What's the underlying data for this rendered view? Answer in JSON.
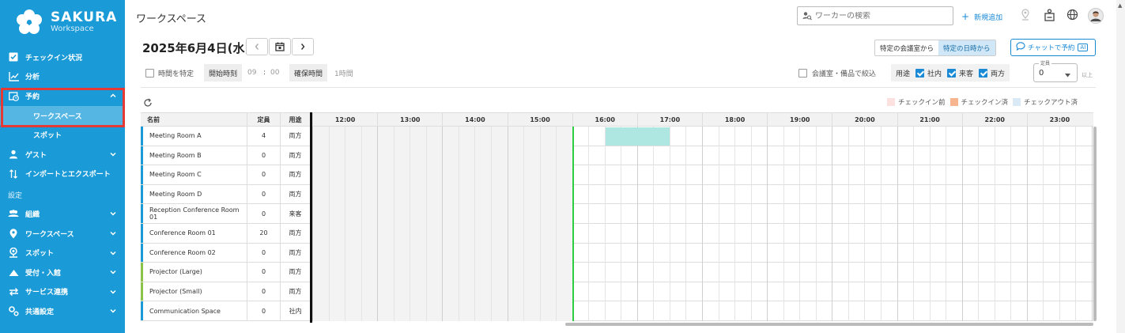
{
  "brand": {
    "name": "SAKURA",
    "sub": "Workspace"
  },
  "sidebar": {
    "items": [
      {
        "label": "チェックイン状況",
        "icon": "checkbox-icon"
      },
      {
        "label": "分析",
        "icon": "chart-line-icon"
      },
      {
        "label": "予約",
        "icon": "calendar-clock-icon",
        "expanded": true
      },
      {
        "label": "ワークスペース",
        "sub": true,
        "active": true
      },
      {
        "label": "スポット",
        "sub": true
      },
      {
        "label": "ゲスト",
        "icon": "guest-icon"
      },
      {
        "label": "インポートとエクスポート",
        "icon": "import-export-icon"
      }
    ],
    "section_label": "設定",
    "settings_items": [
      {
        "label": "組織",
        "icon": "group-icon"
      },
      {
        "label": "ワークスペース",
        "icon": "location-pin-icon"
      },
      {
        "label": "スポット",
        "icon": "person-pin-icon"
      },
      {
        "label": "受付・入館",
        "icon": "reception-icon"
      },
      {
        "label": "サービス連携",
        "icon": "sync-icon"
      },
      {
        "label": "共通設定",
        "icon": "gears-icon"
      }
    ]
  },
  "header": {
    "title": "ワークスペース",
    "search_placeholder": "ワーカーの検索",
    "new_add": "新規追加"
  },
  "date": {
    "label": "2025年6月4日(水)"
  },
  "segment": {
    "options": [
      "特定の会議室から",
      "特定の日時から"
    ],
    "selected_index": 1
  },
  "chat_button": {
    "label": "チャットで予約",
    "badge": "AI"
  },
  "filters": {
    "time_fix": "時間を特定",
    "start_label": "開始時刻",
    "start_hour": "09",
    "start_sep": ":",
    "start_min": "00",
    "duration_label": "確保時間",
    "duration_value": "1時間",
    "narrow_label": "会議室・備品で絞込",
    "usage_label": "用途",
    "usage_options": [
      "社内",
      "来客",
      "両方"
    ],
    "capacity_caption": "定員",
    "capacity_value": "0",
    "capacity_suffix": "以上"
  },
  "legend": [
    "チェックイン前",
    "チェックイン済",
    "チェックアウト済"
  ],
  "colors": {
    "sidebar": "#1a9ad6",
    "accent": "#1a8ad6",
    "legend": [
      "#fde0e0",
      "#f6b58f",
      "#d9e9f5"
    ],
    "booking": "#aee6e1",
    "now_line": "#2ecc40"
  },
  "table": {
    "headers": {
      "name": "名前",
      "capacity": "定員",
      "usage": "用途"
    },
    "hours": [
      "12:00",
      "13:00",
      "14:00",
      "15:00",
      "16:00",
      "17:00",
      "18:00",
      "19:00",
      "20:00",
      "21:00",
      "22:00",
      "23:00"
    ],
    "rows": [
      {
        "name": "Meeting Room A",
        "capacity": "4",
        "usage": "両方",
        "type": "room"
      },
      {
        "name": "Meeting Room B",
        "capacity": "0",
        "usage": "両方",
        "type": "room"
      },
      {
        "name": "Meeting Room C",
        "capacity": "0",
        "usage": "両方",
        "type": "room"
      },
      {
        "name": "Meeting Room D",
        "capacity": "0",
        "usage": "両方",
        "type": "room"
      },
      {
        "name": "Reception Conference Room 01",
        "capacity": "0",
        "usage": "来客",
        "type": "room"
      },
      {
        "name": "Conference Room 01",
        "capacity": "20",
        "usage": "両方",
        "type": "room"
      },
      {
        "name": "Conference Room 02",
        "capacity": "0",
        "usage": "両方",
        "type": "room"
      },
      {
        "name": "Projector (Large)",
        "capacity": "0",
        "usage": "両方",
        "type": "equip"
      },
      {
        "name": "Projector (Small)",
        "capacity": "0",
        "usage": "両方",
        "type": "equip"
      },
      {
        "name": "Communication Space",
        "capacity": "0",
        "usage": "社内",
        "type": "room"
      }
    ],
    "now_time": 16.0,
    "bookings": [
      {
        "row": 0,
        "start": 16.5,
        "end": 17.5
      }
    ]
  }
}
